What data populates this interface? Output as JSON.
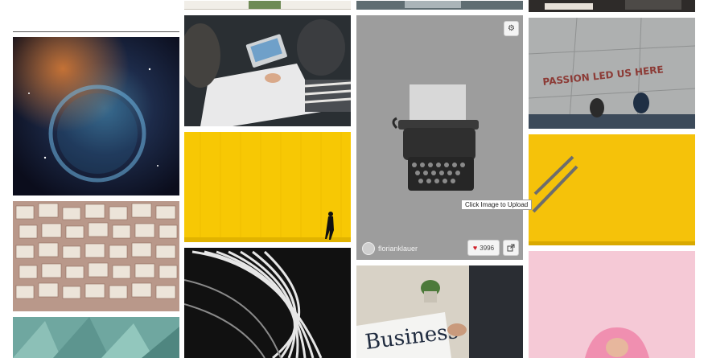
{
  "upload_tooltip": "Click Image to Upload",
  "featured_photo": {
    "author": "florianklauer",
    "likes": "3996",
    "icons": {
      "settings": "gear-icon",
      "like": "heart-icon",
      "open": "external-link-icon",
      "avatar": "avatar"
    }
  },
  "image_text": {
    "floor_message": "PASSION LED US HERE",
    "newspaper_headline": "Business"
  },
  "colors": {
    "like_heart": "#d0202a",
    "tooltip_border": "#9a9a9a"
  }
}
